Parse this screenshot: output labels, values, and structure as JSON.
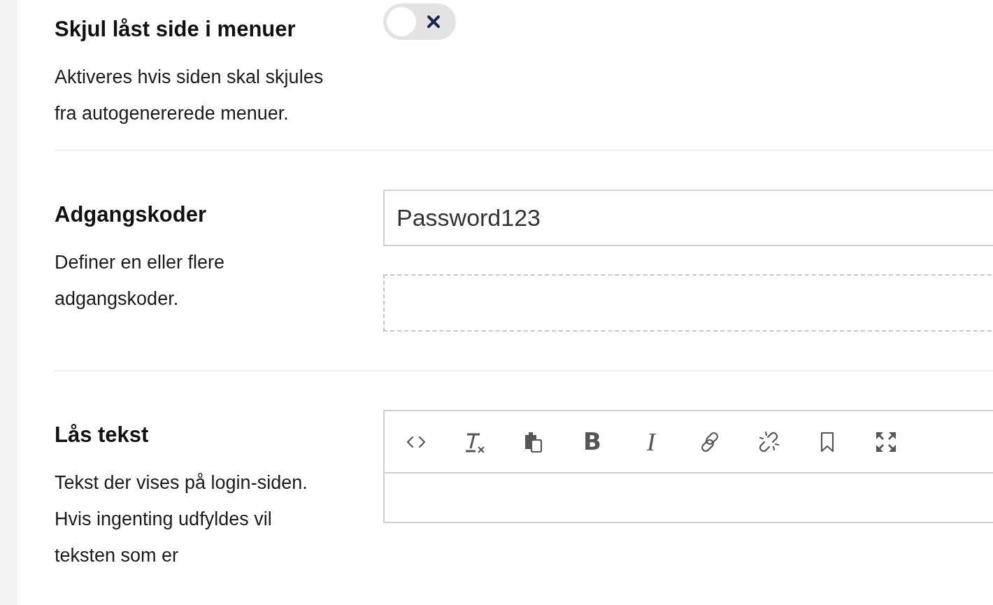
{
  "settings": [
    {
      "kind": "toggle",
      "title": "Skjul låst side i menuer",
      "description": "Aktiveres hvis siden skal skjules fra autogenererede menuer.",
      "on": false
    },
    {
      "kind": "passwords",
      "title": "Adgangskoder",
      "description": "Definer en eller flere adgangskoder.",
      "values": [
        "Password123"
      ]
    },
    {
      "kind": "editor",
      "title": "Lås tekst",
      "description": "Tekst der vises på login-siden. Hvis ingenting udfyldes vil teksten som er",
      "toolbar": [
        {
          "kind": "source"
        },
        {
          "kind": "clear-format"
        },
        {
          "kind": "paste"
        },
        {
          "kind": "bold",
          "label": "B"
        },
        {
          "kind": "italic",
          "label": "I"
        },
        {
          "kind": "link"
        },
        {
          "kind": "unlink"
        },
        {
          "kind": "bookmark"
        },
        {
          "kind": "fullscreen"
        }
      ]
    }
  ]
}
